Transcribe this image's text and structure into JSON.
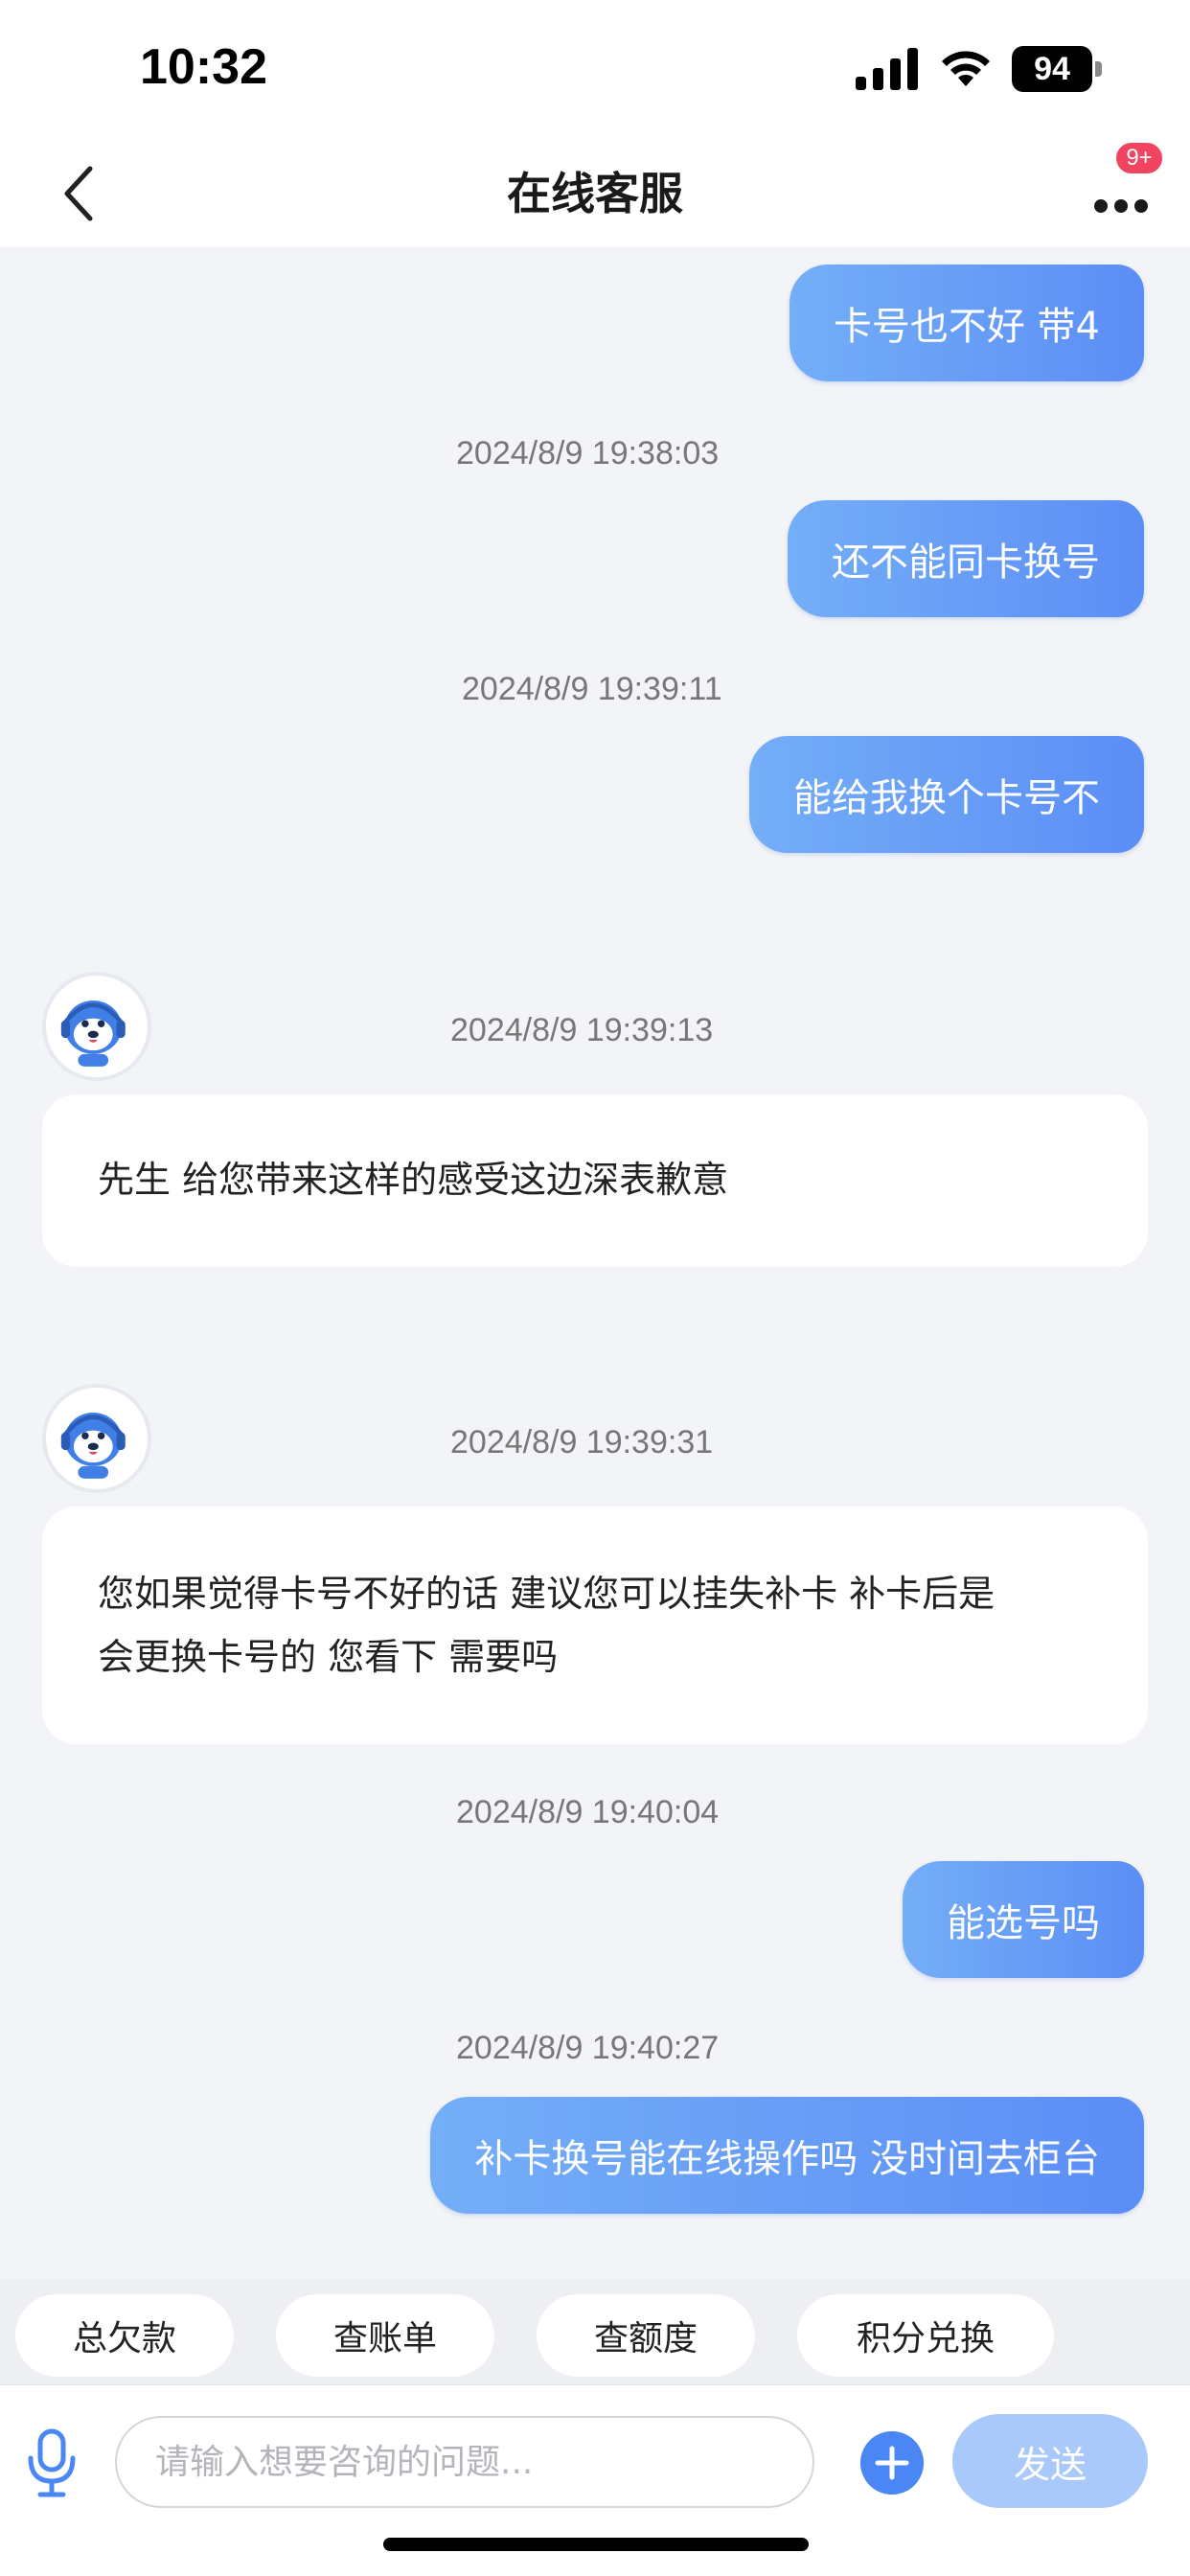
{
  "status_bar": {
    "time": "10:32",
    "battery": "94",
    "icons": [
      "signal-icon",
      "wifi-icon",
      "battery-icon"
    ]
  },
  "header": {
    "title": "在线客服",
    "badge": "9+",
    "icons": [
      "back-chevron-icon",
      "more-dots-icon"
    ]
  },
  "messages": [
    {
      "from": "user",
      "text": "卡号也不好 带4"
    },
    {
      "type": "timestamp",
      "text": "2024/8/9 19:38:03"
    },
    {
      "from": "user",
      "text": "还不能同卡换号"
    },
    {
      "type": "timestamp",
      "text": "2024/8/9 19:39:11"
    },
    {
      "from": "user",
      "text": "能给我换个卡号不"
    },
    {
      "type": "timestamp",
      "text": "2024/8/9 19:39:13"
    },
    {
      "from": "agent",
      "text": "先生 给您带来这样的感受这边深表歉意"
    },
    {
      "type": "timestamp",
      "text": "2024/8/9 19:39:31"
    },
    {
      "from": "agent",
      "lines": [
        "您如果觉得卡号不好的话 建议您可以挂失补卡 补卡后是",
        "会更换卡号的 您看下 需要吗"
      ]
    },
    {
      "type": "timestamp",
      "text": "2024/8/9 19:40:04"
    },
    {
      "from": "user",
      "text": "能选号吗"
    },
    {
      "type": "timestamp",
      "text": "2024/8/9 19:40:27"
    },
    {
      "from": "user",
      "text": "补卡换号能在线操作吗 没时间去柜台"
    }
  ],
  "quick_replies": [
    "总欠款",
    "查账单",
    "查额度",
    "积分兑换"
  ],
  "input": {
    "placeholder": "请输入想要咨询的问题...",
    "value": "",
    "send_label": "发送",
    "icons": [
      "microphone-icon",
      "plus-icon"
    ]
  },
  "colors": {
    "user_bubble_start": "#74aef7",
    "user_bubble_end": "#5b8ef6",
    "badge": "#f24461",
    "accent": "#4a87f5",
    "send_disabled": "#a9c9fb"
  }
}
